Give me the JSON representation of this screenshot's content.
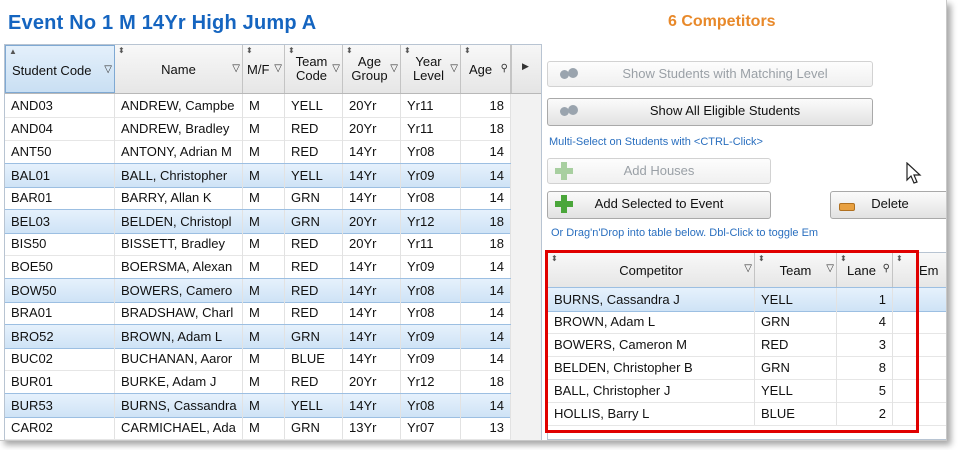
{
  "header": {
    "title": "Event No 1 M 14Yr High Jump A",
    "competitors_count": "6 Competitors"
  },
  "students": {
    "columns": [
      "Student Code",
      "Name",
      "M/F",
      "Team Code",
      "Age Group",
      "Year Level",
      "Age"
    ],
    "rows": [
      {
        "code": "AND03",
        "name": "ANDREW, Campbe",
        "mf": "M",
        "team": "YELL",
        "group": "20Yr",
        "level": "Yr11",
        "age": "18",
        "selected": false
      },
      {
        "code": "AND04",
        "name": "ANDREW, Bradley",
        "mf": "M",
        "team": "RED",
        "group": "20Yr",
        "level": "Yr11",
        "age": "18",
        "selected": false
      },
      {
        "code": "ANT50",
        "name": "ANTONY, Adrian M",
        "mf": "M",
        "team": "RED",
        "group": "14Yr",
        "level": "Yr08",
        "age": "14",
        "selected": false
      },
      {
        "code": "BAL01",
        "name": "BALL, Christopher",
        "mf": "M",
        "team": "YELL",
        "group": "14Yr",
        "level": "Yr09",
        "age": "14",
        "selected": true
      },
      {
        "code": "BAR01",
        "name": "BARRY, Allan K",
        "mf": "M",
        "team": "GRN",
        "group": "14Yr",
        "level": "Yr08",
        "age": "14",
        "selected": false
      },
      {
        "code": "BEL03",
        "name": "BELDEN, Christopl",
        "mf": "M",
        "team": "GRN",
        "group": "20Yr",
        "level": "Yr12",
        "age": "18",
        "selected": true
      },
      {
        "code": "BIS50",
        "name": "BISSETT, Bradley",
        "mf": "M",
        "team": "RED",
        "group": "20Yr",
        "level": "Yr11",
        "age": "18",
        "selected": false
      },
      {
        "code": "BOE50",
        "name": "BOERSMA, Alexan",
        "mf": "M",
        "team": "RED",
        "group": "14Yr",
        "level": "Yr09",
        "age": "14",
        "selected": false
      },
      {
        "code": "BOW50",
        "name": "BOWERS, Camero",
        "mf": "M",
        "team": "RED",
        "group": "14Yr",
        "level": "Yr08",
        "age": "14",
        "selected": true
      },
      {
        "code": "BRA01",
        "name": "BRADSHAW, Charl",
        "mf": "M",
        "team": "RED",
        "group": "14Yr",
        "level": "Yr08",
        "age": "14",
        "selected": false
      },
      {
        "code": "BRO52",
        "name": "BROWN, Adam L",
        "mf": "M",
        "team": "GRN",
        "group": "14Yr",
        "level": "Yr09",
        "age": "14",
        "selected": true
      },
      {
        "code": "BUC02",
        "name": "BUCHANAN, Aaror",
        "mf": "M",
        "team": "BLUE",
        "group": "14Yr",
        "level": "Yr09",
        "age": "14",
        "selected": false
      },
      {
        "code": "BUR01",
        "name": "BURKE, Adam J",
        "mf": "M",
        "team": "RED",
        "group": "20Yr",
        "level": "Yr12",
        "age": "18",
        "selected": false
      },
      {
        "code": "BUR53",
        "name": "BURNS, Cassandra",
        "mf": "M",
        "team": "YELL",
        "group": "14Yr",
        "level": "Yr08",
        "age": "14",
        "selected": true
      },
      {
        "code": "CAR02",
        "name": "CARMICHAEL, Ada",
        "mf": "M",
        "team": "GRN",
        "group": "13Yr",
        "level": "Yr07",
        "age": "13",
        "selected": false
      }
    ]
  },
  "actions": {
    "show_matching": "Show Students with Matching Level",
    "show_all": "Show All Eligible Students",
    "multi_select_hint": "Multi-Select on Students with <CTRL-Click>",
    "add_houses": "Add Houses",
    "add_selected": "Add Selected to Event",
    "delete": "Delete",
    "drag_hint": "Or Drag'n'Drop into table below.  Dbl-Click to toggle Em"
  },
  "competitors": {
    "columns": [
      "Competitor",
      "Team",
      "Lane",
      "Em"
    ],
    "rows": [
      {
        "name": "BURNS, Cassandra J",
        "team": "YELL",
        "lane": "1",
        "selected": true
      },
      {
        "name": "BROWN, Adam L",
        "team": "GRN",
        "lane": "4",
        "selected": false
      },
      {
        "name": "BOWERS, Cameron M",
        "team": "RED",
        "lane": "3",
        "selected": false
      },
      {
        "name": "BELDEN, Christopher B",
        "team": "GRN",
        "lane": "8",
        "selected": false
      },
      {
        "name": "BALL, Christopher J",
        "team": "YELL",
        "lane": "5",
        "selected": false
      },
      {
        "name": "HOLLIS, Barry L",
        "team": "BLUE",
        "lane": "2",
        "selected": false
      }
    ]
  },
  "colors": {
    "title": "#1565c0",
    "count": "#e8892a",
    "hint": "#2a6fbf",
    "highlight_box": "#e00000"
  }
}
